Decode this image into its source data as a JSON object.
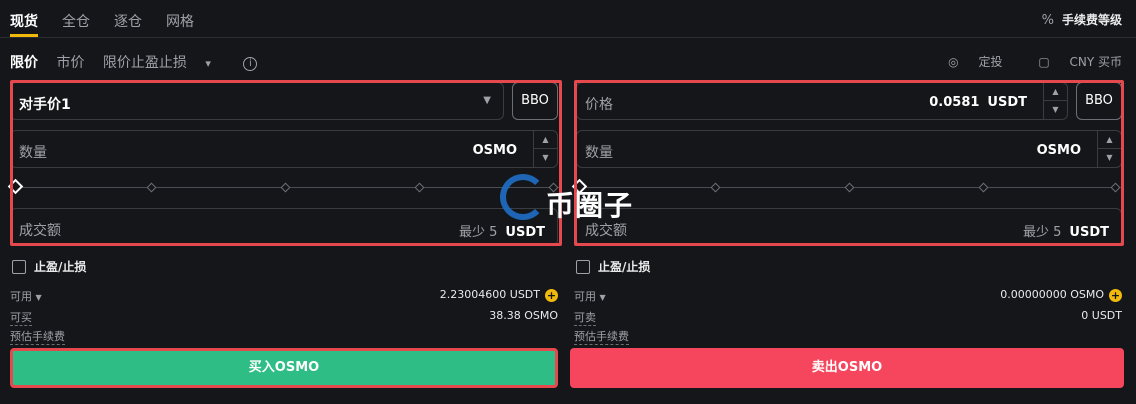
{
  "tabs": [
    {
      "label": "现货",
      "active": true
    },
    {
      "label": "全仓",
      "active": false
    },
    {
      "label": "逐仓",
      "active": false
    },
    {
      "label": "网格",
      "active": false
    }
  ],
  "fee_level": {
    "icon": "percent-icon",
    "label": "手续费等级"
  },
  "order_types": {
    "limit": "限价",
    "market": "市价",
    "tp_sl": "限价止盈止损",
    "tp_sl_caret": "▾",
    "info": "i"
  },
  "right_links": {
    "auto_invest": "定投",
    "cny_buy": "CNY 买币"
  },
  "buy": {
    "price_select": "对手价1",
    "bbo": "BBO",
    "quantity_label": "数量",
    "quantity_unit": "OSMO",
    "amount_label": "成交额",
    "amount_min": "最少 5",
    "amount_unit": "USDT",
    "tp_sl_label": "止盈/止损",
    "available_label": "可用",
    "available_value": "2.23004600 USDT",
    "can_buy_label": "可买",
    "can_buy_value": "38.38 OSMO",
    "est_fee_label": "预估手续费",
    "button": "买入OSMO",
    "slider_fraction": 0
  },
  "sell": {
    "price_label": "价格",
    "price_value": "0.0581",
    "price_unit": "USDT",
    "bbo": "BBO",
    "quantity_label": "数量",
    "quantity_unit": "OSMO",
    "amount_label": "成交额",
    "amount_min": "最少 5",
    "amount_unit": "USDT",
    "tp_sl_label": "止盈/止损",
    "available_label": "可用",
    "available_value": "0.00000000 OSMO",
    "can_sell_label": "可卖",
    "can_sell_value": "0 USDT",
    "est_fee_label": "预估手续费",
    "button": "卖出OSMO",
    "slider_fraction": 0
  },
  "watermark": "币圈子",
  "colors": {
    "buy": "#2ebd85",
    "sell": "#f6465d",
    "accent": "#f0b90b",
    "highlight": "#e5484d"
  }
}
